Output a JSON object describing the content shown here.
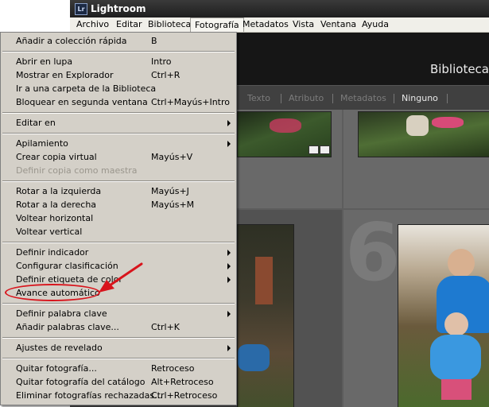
{
  "app": {
    "logo": "Lr",
    "title": "Lightroom",
    "module": "Biblioteca"
  },
  "menubar": [
    "Archivo",
    "Editar",
    "Biblioteca",
    "Fotografía",
    "Metadatos",
    "Vista",
    "Ventana",
    "Ayuda"
  ],
  "filter_bar": [
    "Texto",
    "Atributo",
    "Metadatos",
    "Ninguno"
  ],
  "grid": {
    "cell_number": "6"
  },
  "menu": {
    "items": [
      {
        "label": "Añadir a colección rápida",
        "shortcut": "B"
      },
      {
        "label": "Abrir en lupa",
        "shortcut": "Intro"
      },
      {
        "label": "Mostrar en Explorador",
        "shortcut": "Ctrl+R"
      },
      {
        "label": "Ir a una carpeta de la Biblioteca",
        "shortcut": ""
      },
      {
        "label": "Bloquear en segunda ventana",
        "shortcut": "Ctrl+Mayús+Intro"
      },
      {
        "label": "Editar en",
        "shortcut": "",
        "submenu": true
      },
      {
        "label": "Apilamiento",
        "shortcut": "",
        "submenu": true
      },
      {
        "label": "Crear copia virtual",
        "shortcut": "Mayús+V"
      },
      {
        "label": "Definir copia como maestra",
        "shortcut": "",
        "disabled": true
      },
      {
        "label": "Rotar a la izquierda",
        "shortcut": "Mayús+J"
      },
      {
        "label": "Rotar a la derecha",
        "shortcut": "Mayús+M"
      },
      {
        "label": "Voltear horizontal",
        "shortcut": ""
      },
      {
        "label": "Voltear vertical",
        "shortcut": ""
      },
      {
        "label": "Definir indicador",
        "shortcut": "",
        "submenu": true
      },
      {
        "label": "Configurar clasificación",
        "shortcut": "",
        "submenu": true
      },
      {
        "label": "Definir etiqueta de color",
        "shortcut": "",
        "submenu": true
      },
      {
        "label": "Avance automático",
        "shortcut": ""
      },
      {
        "label": "Definir palabra clave",
        "shortcut": "",
        "submenu": true
      },
      {
        "label": "Añadir palabras clave...",
        "shortcut": "Ctrl+K"
      },
      {
        "label": "Ajustes de revelado",
        "shortcut": "",
        "submenu": true
      },
      {
        "label": "Quitar fotografía...",
        "shortcut": "Retroceso"
      },
      {
        "label": "Quitar fotografía del catálogo",
        "shortcut": "Alt+Retroceso"
      },
      {
        "label": "Eliminar fotografías rechazadas...",
        "shortcut": "Ctrl+Retroceso"
      }
    ]
  },
  "colors": {
    "annotation": "#d8141c",
    "menu_bg": "#d4d0c8",
    "app_bg": "#2b2b2b"
  }
}
